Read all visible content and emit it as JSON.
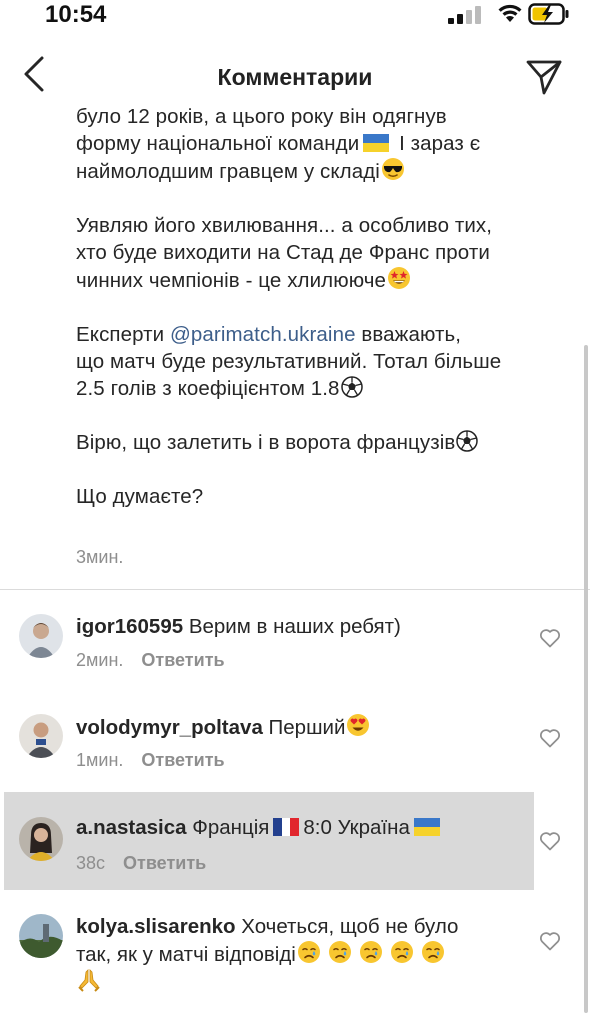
{
  "status_bar": {
    "time": "10:54",
    "icons": [
      "cellular-signal-icon",
      "wifi-icon",
      "battery-charging-icon"
    ]
  },
  "header": {
    "title": "Комментарии",
    "back_icon": "chevron-left-icon",
    "direct_icon": "paper-plane-icon"
  },
  "caption": {
    "lines": [
      "було 12 років, а цього року він одягнув",
      "форму національної команди",
      "I зараз є",
      "наймолодшим гравцем у складі",
      "Уявляю його хвилювання... а особливо тих,",
      "хто буде виходити на Стад де Франс проти",
      "чинних чемпіонів - це хлилююче",
      "Експерти",
      "@parimatch.ukraine",
      "вважають,",
      "що матч буде результативний. Тотал більше",
      "2.5 голів з коефіцієнтом 1.8",
      "Вірю, що залетить і в ворота французів",
      "Що думаєте?"
    ],
    "time": "3мин.",
    "emojis": [
      "ukraine-flag",
      "sunglasses-face",
      "star-struck-face",
      "soccer-ball"
    ]
  },
  "comments": [
    {
      "username": "igor160595",
      "text": "Верим в наших ребят)",
      "time": "2мин.",
      "reply_label": "Ответить",
      "highlighted": false
    },
    {
      "username": "volodymyr_poltava",
      "text": "Перший",
      "emoji": "heart-eyes-face",
      "time": "1мин.",
      "reply_label": "Ответить",
      "highlighted": false
    },
    {
      "username": "a.nastasica",
      "text_before": "Франція",
      "text_after": "8:0 Україна",
      "flags": [
        "france-flag",
        "ukraine-flag"
      ],
      "time": "38с",
      "reply_label": "Ответить",
      "highlighted": true
    },
    {
      "username": "kolya.slisarenko",
      "text_line1": "Хочеться, щоб не було",
      "text_line2": "так, як у матчі відповіді",
      "emojis": [
        "crying-face",
        "crying-face",
        "crying-face",
        "crying-face",
        "crying-face",
        "folded-hands"
      ],
      "highlighted": false
    }
  ],
  "colors": {
    "text": "#262626",
    "secondary": "#8e8e8e",
    "mention": "#3d5e8a",
    "highlight_bg": "#d9d9d9",
    "divider": "#dbdbdb"
  }
}
